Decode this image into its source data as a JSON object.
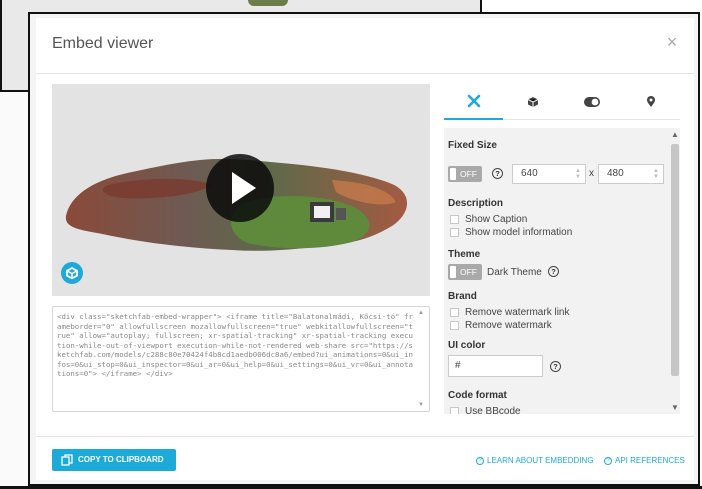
{
  "modal": {
    "title": "Embed viewer",
    "close_icon": "×"
  },
  "viewer": {
    "logo_icon": "sketchfab-logo-icon",
    "play_icon": "play-icon"
  },
  "embed_code": "<div class=\"sketchfab-embed-wrapper\"> <iframe title=\"Balatonalmádi, Kőcsi-tó\" frameborder=\"0\" allowfullscreen mozallowfullscreen=\"true\" webkitallowfullscreen=\"true\" allow=\"autoplay; fullscreen; xr-spatial-tracking\" xr-spatial-tracking execution-while-out-of-viewport execution-while-not-rendered web-share src=\"https://sketchfab.com/models/c288c80e70424f4b8cd1aedb006dc8a6/embed?ui_animations=0&ui_infos=0&ui_stop=0&ui_inspector=0&ui_ar=0&ui_help=0&ui_settings=0&ui_vr=0&ui_annotations=0\"> </iframe> </div>",
  "tabs": [
    {
      "name": "tools-icon",
      "active": true
    },
    {
      "name": "model-icon",
      "active": false
    },
    {
      "name": "toggle-icon",
      "active": false
    },
    {
      "name": "location-pin-icon",
      "active": false
    }
  ],
  "settings": {
    "fixed_size": {
      "title": "Fixed Size",
      "toggle": "OFF",
      "width": "640",
      "height": "480",
      "separator": "x"
    },
    "description": {
      "title": "Description",
      "show_caption": "Show Caption",
      "show_model_info": "Show model information"
    },
    "theme": {
      "title": "Theme",
      "toggle": "OFF",
      "label": "Dark Theme"
    },
    "brand": {
      "title": "Brand",
      "remove_watermark_link": "Remove watermark link",
      "remove_watermark": "Remove watermark"
    },
    "ui_color": {
      "title": "UI color",
      "value": "#"
    },
    "code_format": {
      "title": "Code format",
      "use_bbcode": "Use BBcode"
    },
    "help_glyph": "?"
  },
  "footer": {
    "copy_label": "COPY TO CLIPBOARD",
    "learn_label": "LEARN ABOUT EMBEDDING",
    "api_label": "API REFERENCES",
    "help_glyph": "?"
  },
  "colors": {
    "accent": "#1caad9"
  }
}
